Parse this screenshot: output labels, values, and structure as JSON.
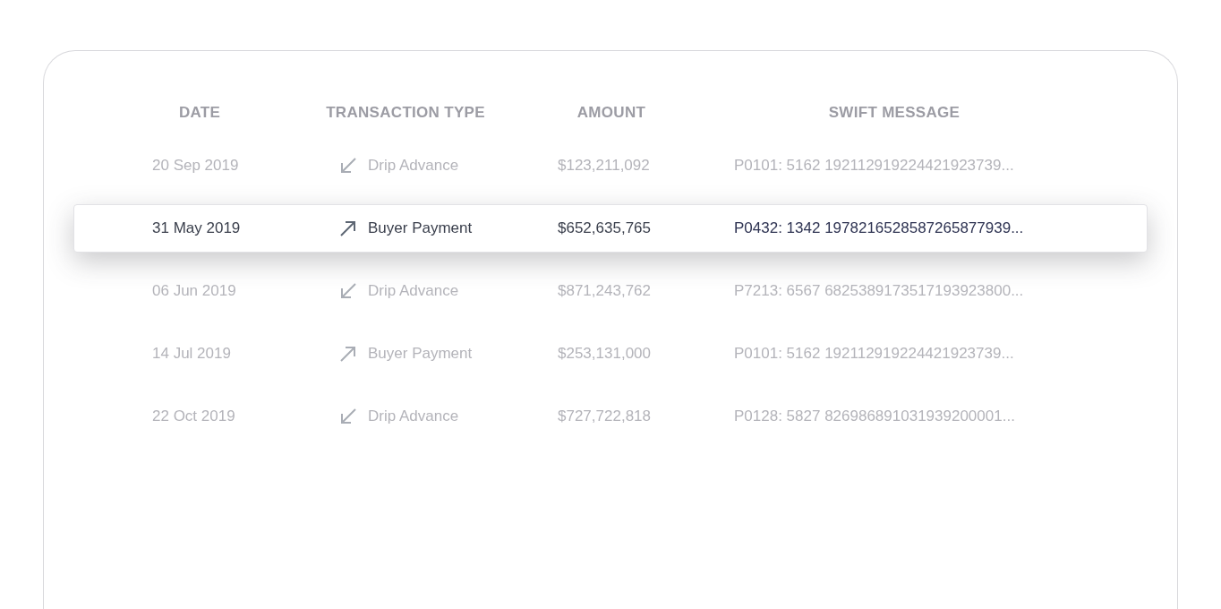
{
  "table": {
    "columns": [
      "DATE",
      "TRANSACTION TYPE",
      "AMOUNT",
      "SWIFT MESSAGE"
    ],
    "rows": [
      {
        "date": "20 Sep 2019",
        "type": {
          "kind": "incoming",
          "label": "Drip Advance"
        },
        "amount": "$123,211,092",
        "swift": "P0101: 5162 192112919224421923739...",
        "selected": false
      },
      {
        "date": "31 May 2019",
        "type": {
          "kind": "outgoing",
          "label": "Buyer Payment"
        },
        "amount": "$652,635,765",
        "swift": "P0432: 1342 1978216528587265877939...",
        "selected": true
      },
      {
        "date": "06 Jun 2019",
        "type": {
          "kind": "incoming",
          "label": "Drip Advance"
        },
        "amount": "$871,243,762",
        "swift": "P7213: 6567 6825389173517193923800...",
        "selected": false
      },
      {
        "date": "14 Jul 2019",
        "type": {
          "kind": "outgoing",
          "label": "Buyer Payment"
        },
        "amount": "$253,131,000",
        "swift": "P0101: 5162 192112919224421923739...",
        "selected": false
      },
      {
        "date": "22 Oct 2019",
        "type": {
          "kind": "incoming",
          "label": "Drip Advance"
        },
        "amount": "$727,722,818",
        "swift": "P0128: 5827 826986891031939200001...",
        "selected": false
      }
    ]
  }
}
